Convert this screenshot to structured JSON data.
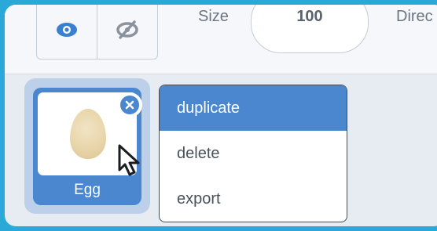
{
  "toolbar": {
    "size_label": "Size",
    "size_value": "100",
    "direction_label": "Direc"
  },
  "sprite": {
    "name": "Egg",
    "delete_icon": "close-icon",
    "thumbnail": "egg"
  },
  "context_menu": {
    "items": [
      {
        "label": "duplicate",
        "highlighted": true
      },
      {
        "label": "delete",
        "highlighted": false
      },
      {
        "label": "export",
        "highlighted": false
      }
    ]
  },
  "colors": {
    "frame_border": "#2aa8d8",
    "accent": "#4a87cf",
    "selection_glow": "#bcd0ea"
  }
}
